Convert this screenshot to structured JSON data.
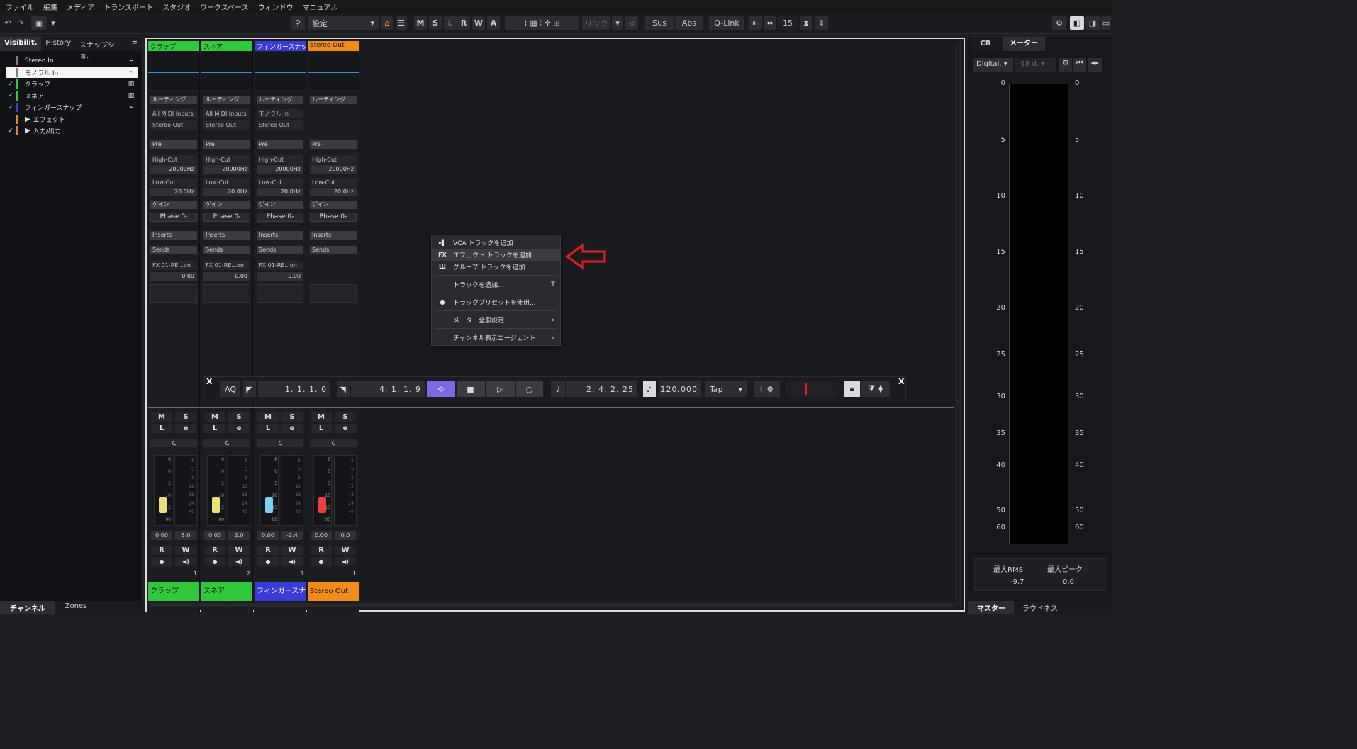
{
  "menu": [
    "ファイル",
    "編集",
    "メディア",
    "トランスポート",
    "スタジオ",
    "ワークスペース",
    "ウィンドウ",
    "マニュアル"
  ],
  "toolbar": {
    "preset": "設定",
    "buttons": [
      "M",
      "S",
      "L",
      "R",
      "W",
      "A"
    ],
    "link": "リンク",
    "sus": "Sus",
    "abs": "Abs",
    "qlink": "Q-Link",
    "value": "15"
  },
  "left": {
    "tabs": [
      "Visibilit.",
      "History",
      "スナップショ."
    ],
    "menu": "=",
    "tracks": [
      {
        "name": "Stereo In",
        "check": "",
        "color": "#808080",
        "icon": "⌁"
      },
      {
        "name": "モノラル In",
        "check": "",
        "color": "#808080",
        "icon": "⌁"
      },
      {
        "name": "クラップ",
        "check": "✓",
        "color": "#2ecc40",
        "icon": "▥"
      },
      {
        "name": "スネア",
        "check": "✓",
        "color": "#2ecc40",
        "icon": "▥"
      },
      {
        "name": "フィンガースナップ",
        "check": "✓",
        "color": "#3b3bd6",
        "icon": "⌁"
      },
      {
        "name": "エフェクト",
        "check": "",
        "color": "#e08a1e",
        "icon": ""
      },
      {
        "name": "入力/出力",
        "check": "✓",
        "color": "#e08a1e",
        "icon": ""
      }
    ],
    "bottomTabs": [
      "チャンネル",
      "Zones"
    ]
  },
  "channels": [
    {
      "name": "クラップ",
      "color": "#31c83d",
      "routing": "ルーティング",
      "input": "All MIDI Inputs",
      "output": "Stereo Out",
      "pre": "Pre",
      "highcut": "High-Cut",
      "hcval": "20000Hz",
      "lowcut": "Low-Cut",
      "lcval": "20.0Hz",
      "gain": "ゲイン",
      "phase": "Phase 0-",
      "inserts": "Inserts",
      "sends": "Sends",
      "fx": "FX 01-RE...on",
      "fxval": "0.00",
      "vol": "0.00",
      "peak": "6.0",
      "num": "1",
      "fader": "#e8e07a",
      "level": 0.3
    },
    {
      "name": "スネア",
      "color": "#31c83d",
      "routing": "ルーティング",
      "input": "All MIDI Inputs",
      "output": "Stereo Out",
      "pre": "Pre",
      "highcut": "High-Cut",
      "hcval": "20000Hz",
      "lowcut": "Low-Cut",
      "lcval": "20.0Hz",
      "gain": "ゲイン",
      "phase": "Phase 0-",
      "inserts": "Inserts",
      "sends": "Sends",
      "fx": "FX 01-RE...on",
      "fxval": "0.00",
      "vol": "0.00",
      "peak": "2.0",
      "num": "2",
      "fader": "#e8e07a",
      "level": 0.3
    },
    {
      "name": "フィンガースナップ",
      "color": "#3a3ad8",
      "routing": "ルーティング",
      "input": "モノラル In",
      "output": "Stereo Out",
      "pre": "Pre",
      "highcut": "High-Cut",
      "hcval": "20000Hz",
      "lowcut": "Low-Cut",
      "lcval": "20.0Hz",
      "gain": "ゲイン",
      "phase": "Phase 0-",
      "inserts": "Inserts",
      "sends": "Sends",
      "fx": "FX 01-RE...on",
      "fxval": "0.00",
      "vol": "0.00",
      "peak": "-2.4",
      "num": "3",
      "fader": "#7cd0f0",
      "level": 0.3
    },
    {
      "name": "Stereo Out",
      "color": "#f08c1a",
      "routing": "ルーティング",
      "input": "",
      "output": "",
      "pre": "Pre",
      "highcut": "High-Cut",
      "hcval": "20000Hz",
      "lowcut": "Low-Cut",
      "lcval": "20.0Hz",
      "gain": "ゲイン",
      "phase": "Phase 0-",
      "inserts": "Inserts",
      "sends": "Sends",
      "fx": "",
      "fxval": "",
      "vol": "0.00",
      "peak": "0.0",
      "num": "1",
      "fader": "#e84040",
      "level": 0.3
    }
  ],
  "strip_labels": {
    "m": "M",
    "s": "S",
    "l": "L",
    "e": "e",
    "r": "R",
    "w": "W",
    "lr": "ح"
  },
  "faderScale": [
    "6",
    "0",
    "5",
    "10",
    "15",
    "00"
  ],
  "meterScale": [
    "6",
    "0",
    "6",
    "12",
    "18",
    "24",
    "40"
  ],
  "context": [
    {
      "icon": "▸▌",
      "label": "VCA トラックを追加",
      "shortcut": ""
    },
    {
      "icon": "FX",
      "label": "エフェクト トラックを追加",
      "shortcut": ""
    },
    {
      "icon": "Ш",
      "label": "グループ トラックを追加",
      "shortcut": ""
    },
    {
      "icon": "",
      "label": "トラックを追加...",
      "shortcut": "T"
    },
    {
      "icon": "●",
      "label": "トラックプリセットを使用...",
      "shortcut": ""
    },
    {
      "icon": "",
      "label": "メーター全般設定",
      "shortcut": "›"
    },
    {
      "icon": "",
      "label": "チャンネル表示エージェント",
      "shortcut": "›"
    }
  ],
  "transport": {
    "aq": "AQ",
    "left": "1. 1. 1.  0",
    "right": "4. 1. 1.  9",
    "pos": "2. 4. 2. 25",
    "tempo": "120.000",
    "tap": "Tap",
    "close": "X"
  },
  "right": {
    "tabs": [
      "CR",
      "メーター"
    ],
    "digital": "Digital.",
    "ref": "-18 d.",
    "scale": [
      "0",
      "5",
      "10",
      "15",
      "20",
      "25",
      "30",
      "35",
      "40",
      "50",
      "60"
    ],
    "rmsLabel": "最大RMS",
    "peakLabel": "最大ピーク",
    "rms": "-9.7",
    "peak": "0.0",
    "bottomTabs": [
      "マスター",
      "ラウドネス"
    ]
  }
}
